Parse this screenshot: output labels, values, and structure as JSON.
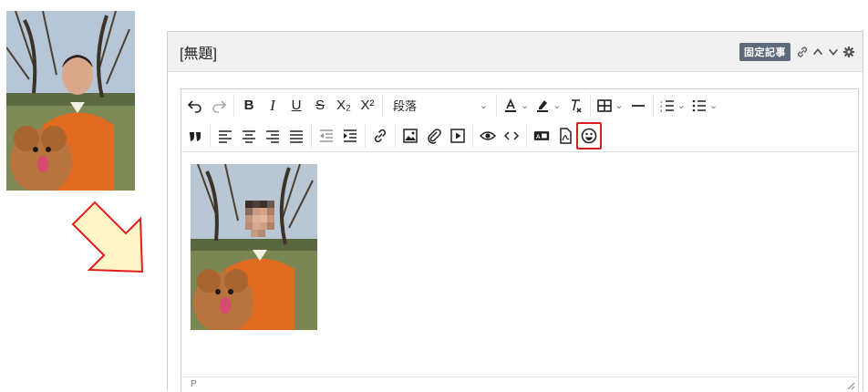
{
  "post": {
    "title": "[無題]",
    "badge": "固定記事"
  },
  "toolbar": {
    "row1": [
      {
        "icon": "undo-icon",
        "glyph": "↶"
      },
      {
        "icon": "redo-icon",
        "glyph": "↷"
      },
      {
        "icon": "bold-icon",
        "glyph": "B"
      },
      {
        "icon": "italic-icon",
        "glyph": "I"
      },
      {
        "icon": "underline-icon",
        "glyph": "U"
      },
      {
        "icon": "strikethrough-icon",
        "glyph": "S"
      },
      {
        "icon": "subscript-icon",
        "glyph": "X₂"
      },
      {
        "icon": "superscript-icon",
        "glyph": "X²"
      }
    ],
    "block_format_value": "段落"
  },
  "status": {
    "path": "P"
  },
  "colors": {
    "highlight_outline": "#d61f1f",
    "badge_bg": "#5f6b7a",
    "arrow_fill": "#fff3c8",
    "arrow_stroke": "#e21c1c",
    "sweater": "#e06a1f"
  }
}
